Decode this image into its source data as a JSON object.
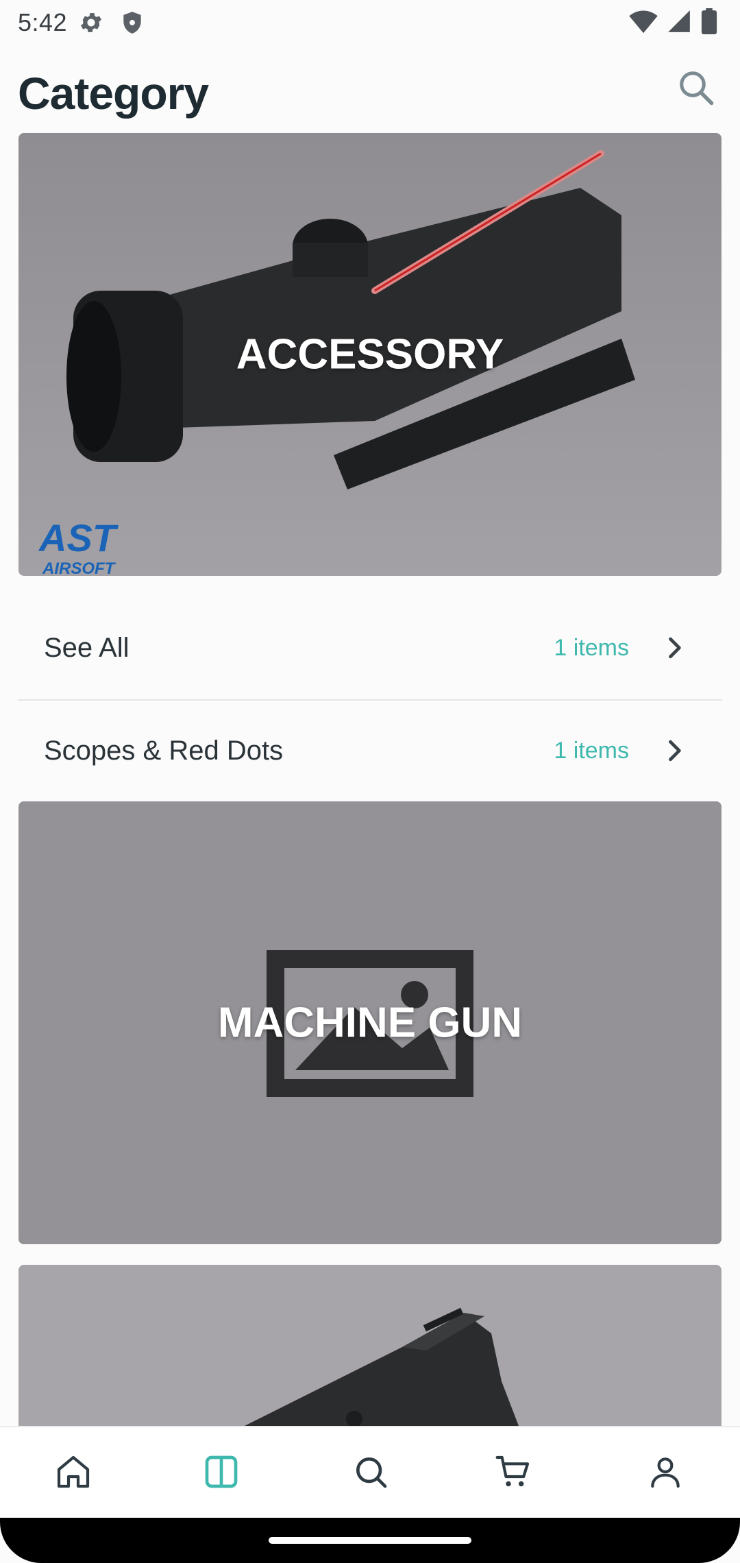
{
  "status_bar": {
    "time": "5:42",
    "left_icons": [
      "settings-icon",
      "shield-icon"
    ],
    "right_icons": [
      "wifi-icon",
      "signal-icon",
      "battery-icon"
    ]
  },
  "header": {
    "title": "Category",
    "search_icon": "search-icon"
  },
  "categories": [
    {
      "title": "ACCESSORY",
      "image_badge_text": "AST AIRSOFT",
      "subcategories": [
        {
          "label": "See All",
          "count": "1 items"
        },
        {
          "label": "Scopes & Red Dots",
          "count": "1 items"
        }
      ]
    },
    {
      "title": "MACHINE GUN",
      "image": "placeholder-image"
    },
    {
      "title": "",
      "image": "pistol-photo"
    }
  ],
  "bottom_nav": {
    "items": [
      {
        "name": "home",
        "icon": "home-icon",
        "active": false
      },
      {
        "name": "category",
        "icon": "category-icon",
        "active": true
      },
      {
        "name": "search",
        "icon": "search-icon",
        "active": false
      },
      {
        "name": "cart",
        "icon": "cart-icon",
        "active": false
      },
      {
        "name": "account",
        "icon": "user-icon",
        "active": false
      }
    ]
  },
  "colors": {
    "accent": "#3fb8ad",
    "active_nav": "#3fb8ad",
    "nav_inactive": "#2f3b43",
    "banner_overlay": "#8e8b90"
  }
}
